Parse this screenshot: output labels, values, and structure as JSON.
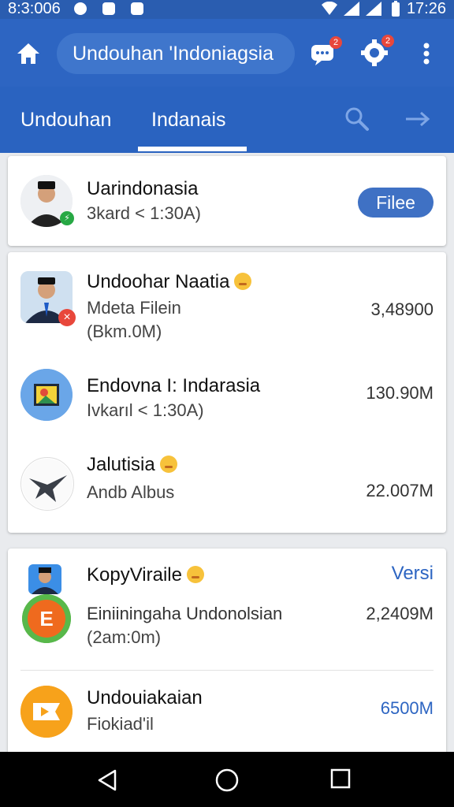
{
  "status_bar": {
    "time_left": "8:3:006",
    "time_right": "17:26",
    "icons_left": [
      "app-icon",
      "gallery-icon",
      "check-icon"
    ],
    "icons_right": [
      "wifi-icon",
      "signal-icon",
      "battery-icon"
    ]
  },
  "app_bar": {
    "search_text": "Undouhan 'Indoniagsia",
    "message_badge": "2",
    "settings_badge": "2"
  },
  "tabs": {
    "items": [
      "Undouhan",
      "Indanais"
    ],
    "active_index": 1
  },
  "header_item": {
    "title": "Uarindonasia",
    "subtitle": "3kard < 1:30A)",
    "button_label": "Filee"
  },
  "list1": [
    {
      "title": "Undoohar Naatia",
      "line1": "Mdeta Filein",
      "line2": "(Bkm.0M)",
      "value": "3,48900"
    },
    {
      "title": "Endovna I: Indarasia",
      "line1": "Ivkarıl < 1:30A)",
      "value": "130.90M"
    },
    {
      "title": "Jalutisia",
      "line1": "Andb Albus",
      "value": "22.007M"
    }
  ],
  "list2": {
    "header_title": "KopyViraile",
    "header_link": "Versi",
    "items": [
      {
        "title": "Einiiningaha Undonolsian",
        "line1": "(2am:0m)",
        "value": "2,2409M",
        "avatar_letter": "E"
      },
      {
        "title": "Undouiakaian",
        "line1": "Fiokiad'il",
        "value": "6500M"
      }
    ]
  },
  "colors": {
    "primary": "#2d65c2",
    "status_bar": "#2a5db0",
    "accent_blue": "#3f71c4",
    "badge_red": "#e8473b"
  }
}
